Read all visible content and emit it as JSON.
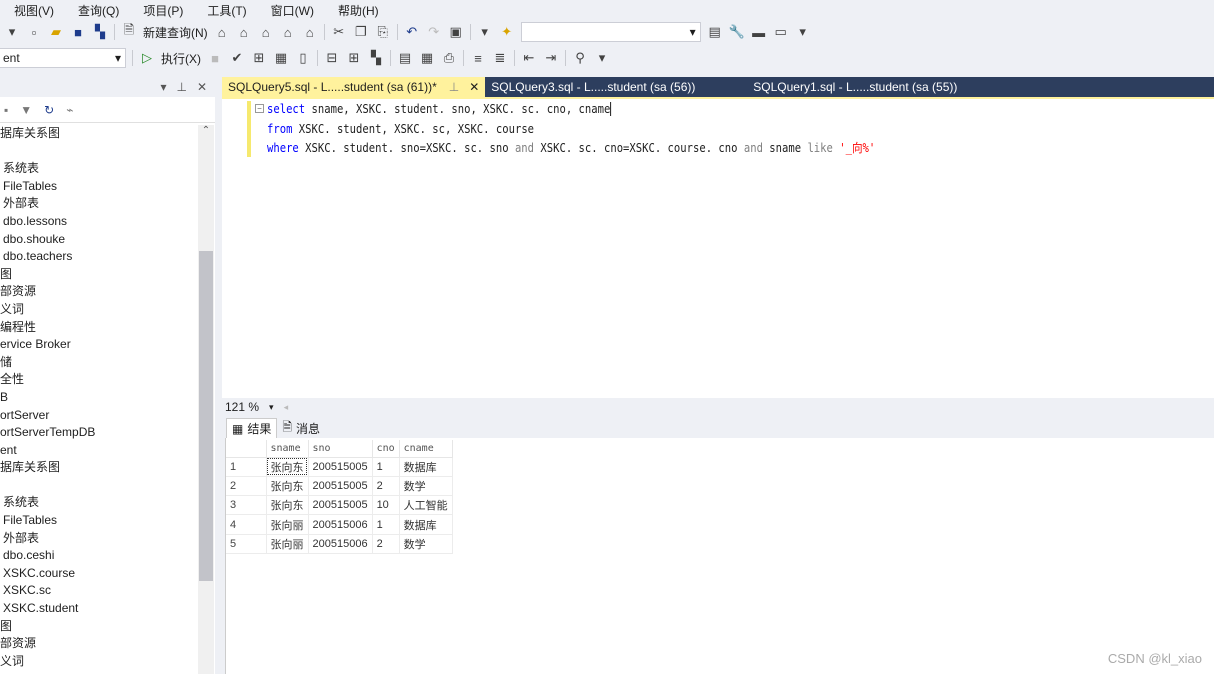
{
  "menu": [
    "视图(V)",
    "查询(Q)",
    "项目(P)",
    "工具(T)",
    "窗口(W)",
    "帮助(H)"
  ],
  "toolbar": {
    "new_query": "新建查询(N)",
    "execute": "执行(X)",
    "database": "ent"
  },
  "left_panel": {
    "tree": [
      {
        "label": "据库关系图",
        "indent": 0
      },
      {
        "label": "",
        "indent": 0
      },
      {
        "label": "系统表",
        "indent": 1
      },
      {
        "label": "FileTables",
        "indent": 1
      },
      {
        "label": "外部表",
        "indent": 1
      },
      {
        "label": "dbo.lessons",
        "indent": 1
      },
      {
        "label": "dbo.shouke",
        "indent": 1
      },
      {
        "label": "dbo.teachers",
        "indent": 1
      },
      {
        "label": "图",
        "indent": 0
      },
      {
        "label": "部资源",
        "indent": 0
      },
      {
        "label": "义词",
        "indent": 0
      },
      {
        "label": "编程性",
        "indent": 0
      },
      {
        "label": "ervice Broker",
        "indent": 0
      },
      {
        "label": "储",
        "indent": 0
      },
      {
        "label": "全性",
        "indent": 0
      },
      {
        "label": "B",
        "indent": 0
      },
      {
        "label": "ortServer",
        "indent": 0
      },
      {
        "label": "ortServerTempDB",
        "indent": 0
      },
      {
        "label": "ent",
        "indent": 0
      },
      {
        "label": "据库关系图",
        "indent": 0
      },
      {
        "label": "",
        "indent": 0
      },
      {
        "label": "系统表",
        "indent": 1
      },
      {
        "label": "FileTables",
        "indent": 1
      },
      {
        "label": "外部表",
        "indent": 1
      },
      {
        "label": "dbo.ceshi",
        "indent": 1
      },
      {
        "label": "XSKC.course",
        "indent": 1
      },
      {
        "label": "XSKC.sc",
        "indent": 1
      },
      {
        "label": "XSKC.student",
        "indent": 1
      },
      {
        "label": "图",
        "indent": 0
      },
      {
        "label": "部资源",
        "indent": 0
      },
      {
        "label": "义词",
        "indent": 0
      }
    ]
  },
  "tabs": [
    {
      "label": "SQLQuery5.sql - L.....student (sa (61))*",
      "active": true
    },
    {
      "label": "SQLQuery3.sql - L.....student (sa (56))",
      "active": false
    },
    {
      "label": "SQLQuery1.sql - L.....student (sa (55))",
      "active": false
    }
  ],
  "code": {
    "l1": {
      "kw": "select",
      "rest": " sname, XSKC. student. sno, XSKC. sc. cno, cname"
    },
    "l2": {
      "kw": "from",
      "rest": " XSKC. student, XSKC. sc, XSKC. course"
    },
    "l3": {
      "kw": "where",
      "a": " XSKC. student. sno=XSKC. sc. sno ",
      "and1": "and",
      "b": " XSKC. sc. cno=XSKC. course. cno ",
      "and2": "and",
      "c": " sname ",
      "like": "like",
      "str": " '_向%'"
    }
  },
  "zoom": "121 %",
  "result_tabs": {
    "results": "结果",
    "messages": "消息"
  },
  "grid": {
    "columns": [
      "sname",
      "sno",
      "cno",
      "cname"
    ],
    "rows": [
      [
        "1",
        "张向东",
        "200515005",
        "1",
        "数据库"
      ],
      [
        "2",
        "张向东",
        "200515005",
        "2",
        "数学"
      ],
      [
        "3",
        "张向东",
        "200515005",
        "10",
        "人工智能"
      ],
      [
        "4",
        "张向丽",
        "200515006",
        "1",
        "数据库"
      ],
      [
        "5",
        "张向丽",
        "200515006",
        "2",
        "数学"
      ]
    ]
  },
  "watermark": "CSDN @kl_xiao"
}
